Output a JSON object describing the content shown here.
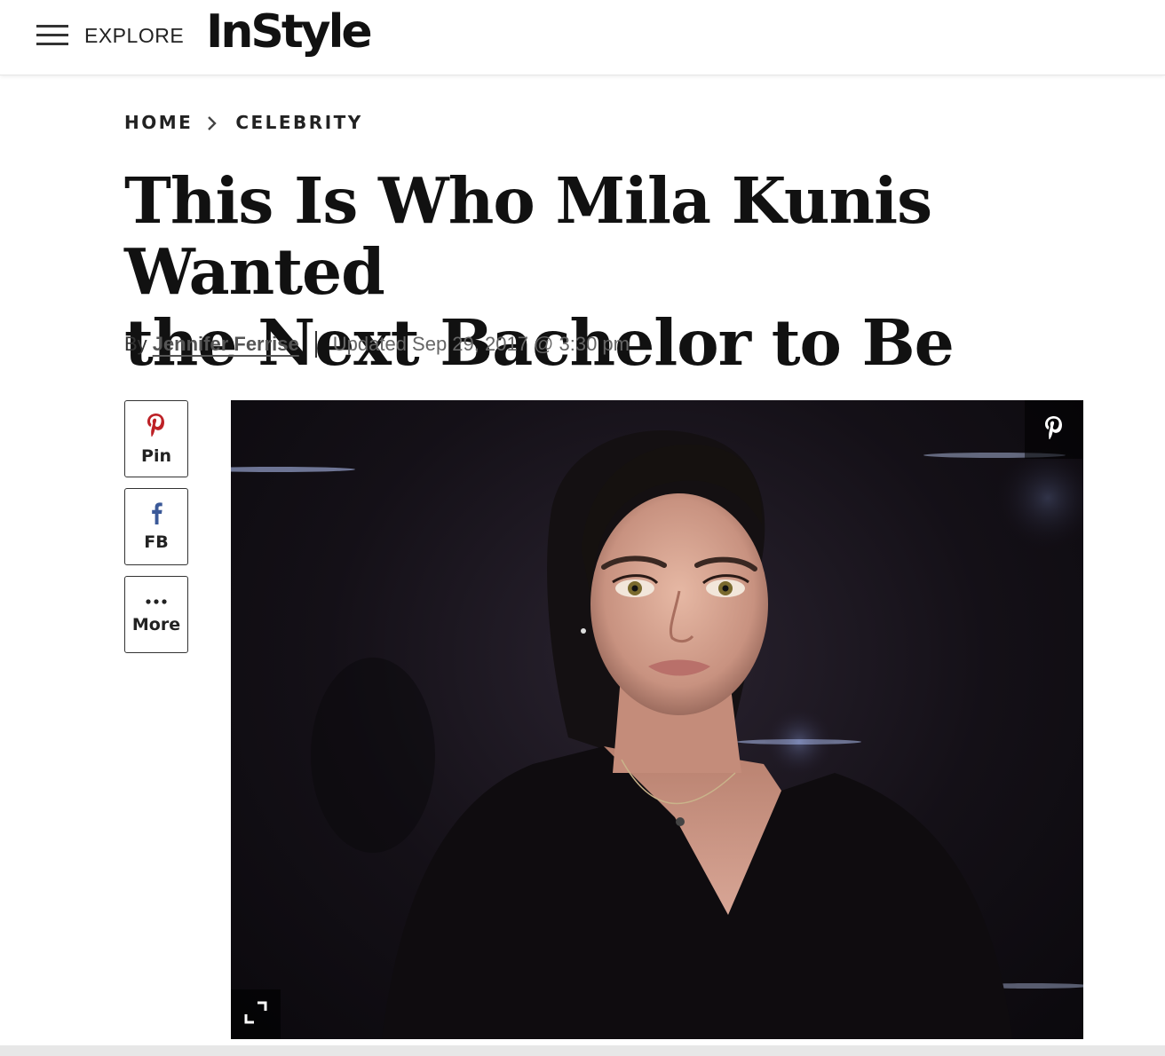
{
  "header": {
    "explore_label": "EXPLORE",
    "logo_text": "InStyle"
  },
  "breadcrumb": {
    "items": [
      "HOME",
      "CELEBRITY"
    ]
  },
  "article": {
    "title_line1": "This Is Who Mila Kunis Wanted",
    "title_line2": "the Next Bachelor to Be",
    "byline_prefix": "By",
    "author": "Jennifer Ferrise",
    "updated": "Updated Sep 29, 2017 @ 3:30 pm"
  },
  "share": {
    "pin_label": "Pin",
    "fb_label": "FB",
    "more_label": "More",
    "pin_icon": "pinterest-icon",
    "fb_icon": "facebook-icon",
    "more_icon": "ellipsis-icon"
  },
  "hero": {
    "overlay_icons": [
      "pinterest-icon",
      "expand-icon"
    ]
  },
  "colors": {
    "pinterest": "#bd2126",
    "facebook": "#3b5998",
    "text": "#111111"
  }
}
